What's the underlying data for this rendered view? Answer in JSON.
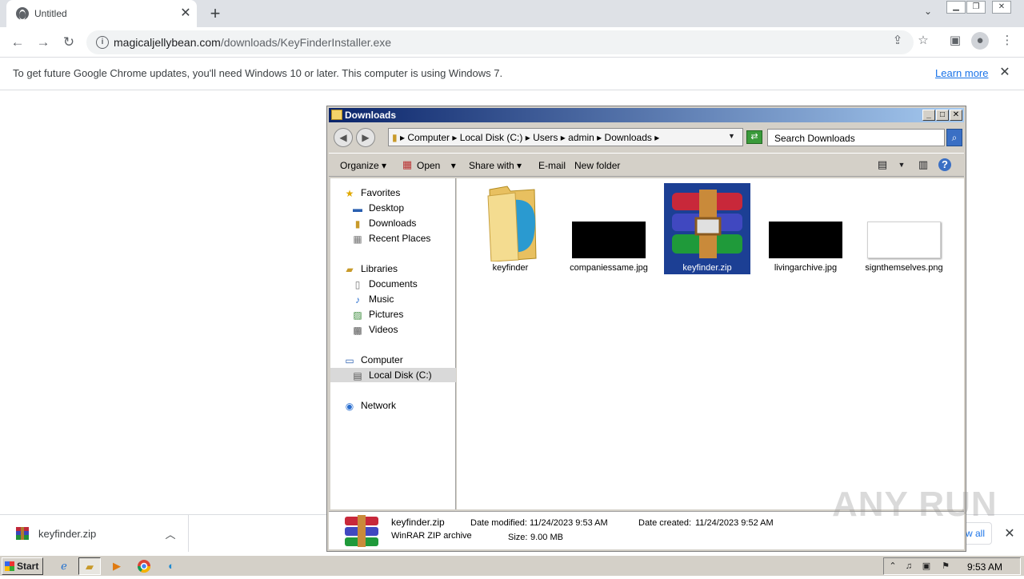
{
  "browser": {
    "tab_title": "Untitled",
    "url_host": "magicaljellybean.com",
    "url_path": "/downloads/KeyFinderInstaller.exe"
  },
  "infobar": {
    "message": "To get future Google Chrome updates, you'll need Windows 10 or later. This computer is using Windows 7.",
    "learn_more": "Learn more"
  },
  "shelf": {
    "download_name": "keyfinder.zip",
    "show_all": "w all"
  },
  "explorer": {
    "title": "Downloads",
    "breadcrumb": [
      "Computer",
      "Local Disk (C:)",
      "Users",
      "admin",
      "Downloads"
    ],
    "search_placeholder": "Search Downloads",
    "commands": {
      "organize": "Organize",
      "open": "Open",
      "share_with": "Share with",
      "email": "E-mail",
      "new_folder": "New folder"
    },
    "nav": {
      "favorites": "Favorites",
      "desktop": "Desktop",
      "downloads": "Downloads",
      "recent_places": "Recent Places",
      "libraries": "Libraries",
      "documents": "Documents",
      "music": "Music",
      "pictures": "Pictures",
      "videos": "Videos",
      "computer": "Computer",
      "local_disk": "Local Disk (C:)",
      "network": "Network"
    },
    "files": [
      {
        "name": "keyfinder",
        "kind": "folder"
      },
      {
        "name": "companiessame.jpg",
        "kind": "black-image"
      },
      {
        "name": "keyfinder.zip",
        "kind": "winrar",
        "selected": true
      },
      {
        "name": "livingarchive.jpg",
        "kind": "black-image"
      },
      {
        "name": "signthemselves.png",
        "kind": "white-image"
      }
    ],
    "details": {
      "name": "keyfinder.zip",
      "type": "WinRAR ZIP archive",
      "modified_label": "Date modified:",
      "modified_value": "11/24/2023 9:53 AM",
      "size_label": "Size:",
      "size_value": "9.00 MB",
      "created_label": "Date created:",
      "created_value": "11/24/2023 9:52 AM"
    }
  },
  "taskbar": {
    "start": "Start",
    "clock": "9:53 AM"
  },
  "watermark": "ANY RUN"
}
